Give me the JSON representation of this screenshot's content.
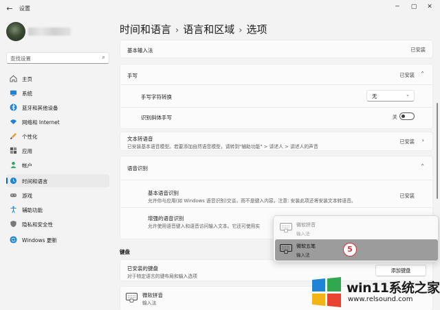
{
  "window": {
    "title": "设置",
    "back_glyph": "←",
    "minimize_glyph": "─",
    "maximize_glyph": "▢",
    "close_glyph": "✕"
  },
  "search": {
    "placeholder": "查找设置"
  },
  "sidebar": {
    "items": [
      {
        "label": "主页",
        "icon": "home-icon",
        "active": false
      },
      {
        "label": "系统",
        "icon": "monitor-icon",
        "active": false
      },
      {
        "label": "蓝牙和其他设备",
        "icon": "bluetooth-icon",
        "active": false
      },
      {
        "label": "网络和 Internet",
        "icon": "wifi-icon",
        "active": false
      },
      {
        "label": "个性化",
        "icon": "brush-icon",
        "active": false
      },
      {
        "label": "应用",
        "icon": "apps-icon",
        "active": false
      },
      {
        "label": "帐户",
        "icon": "person-icon",
        "active": false
      },
      {
        "label": "时间和语言",
        "icon": "globe-clock-icon",
        "active": true
      },
      {
        "label": "游戏",
        "icon": "gamepad-icon",
        "active": false
      },
      {
        "label": "辅助功能",
        "icon": "accessibility-icon",
        "active": false
      },
      {
        "label": "隐私和安全性",
        "icon": "shield-icon",
        "active": false
      },
      {
        "label": "Windows 更新",
        "icon": "sync-icon",
        "active": false
      }
    ]
  },
  "breadcrumb": {
    "part1": "时间和语言",
    "part2": "语言和区域",
    "current": "选项",
    "separator": "›"
  },
  "main": {
    "basic_input": {
      "title": "基本输入法",
      "status": "已安装"
    },
    "handwriting": {
      "title": "手写",
      "status": "已安装",
      "font_label": "手写字符转换",
      "font_value": "无",
      "italic_label": "识别斜体手写",
      "italic_state": "关"
    },
    "tts": {
      "title": "文本转语音",
      "desc": "已安装基本语音模型。若要添加自然语音模型，请转到\"辅助功能\" > 讲述人 > 讲述人的声音",
      "status": "已安装"
    },
    "speech": {
      "title": "语音识别",
      "basic_title": "基本语音识别",
      "basic_desc": "允许你与应用(如 Windows 语音识别)交谈，而不是键入内容。注意: 安装此项还将安装文本转语音。",
      "basic_status": "已安装",
      "enhanced_title": "增强的语音识别",
      "enhanced_desc": "允许使用语音键入和语音访问输入文本。它还可使用实"
    },
    "keyboard_section": "键盘",
    "installed_keyboards": {
      "title": "已安装的键盘",
      "desc": "对于特定语言的键布局和输入选项",
      "add_button": "添加键盘"
    },
    "keyboard_entry": {
      "name": "微软拼音",
      "type": "输入法"
    }
  },
  "ime_popup": {
    "items": [
      {
        "name": "微软拼音",
        "type": "输入法",
        "selected": false
      },
      {
        "name": "微软五笔",
        "type": "输入法",
        "selected": true
      }
    ]
  },
  "step_badge": "5",
  "watermark": {
    "title": "win11系统之家",
    "url": "www.relsound.com"
  },
  "colors": {
    "accent": "#0067c0",
    "badge": "#d63333",
    "background": "#f3f3f3"
  }
}
